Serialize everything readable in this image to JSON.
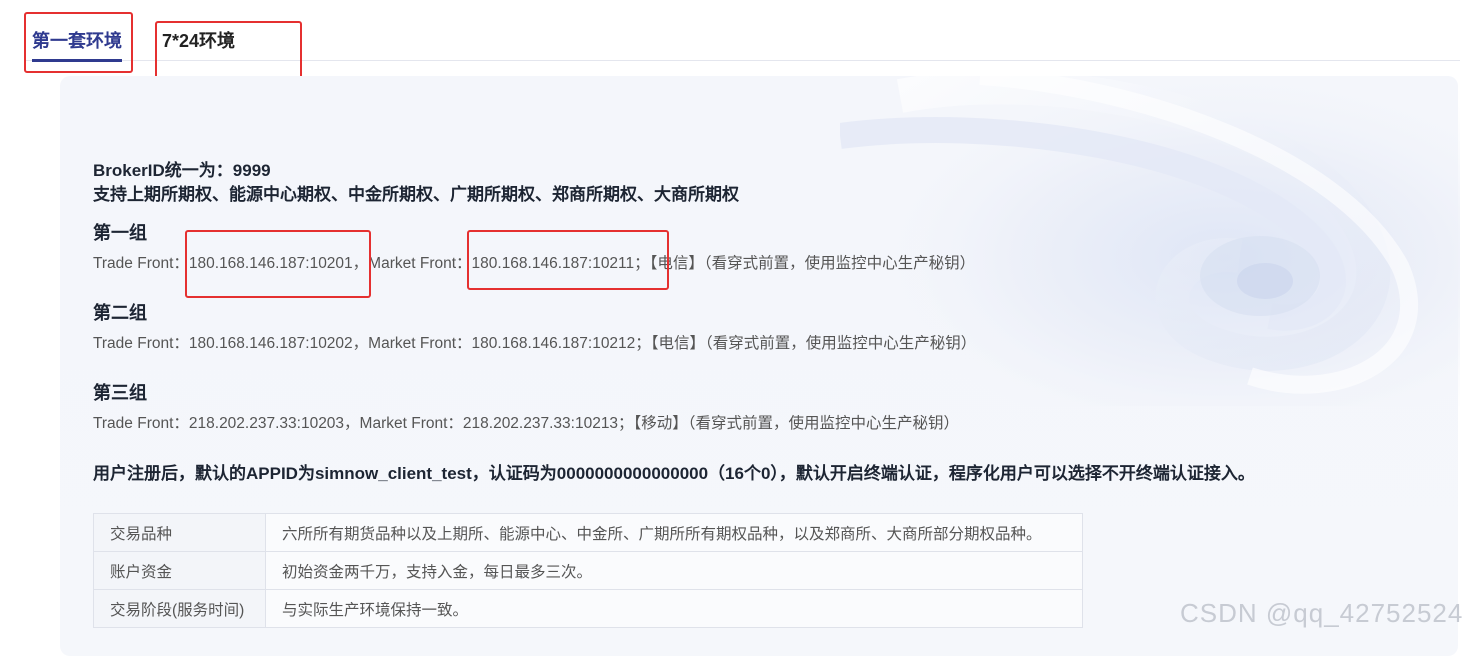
{
  "tabs": [
    {
      "label": "第一套环境",
      "active": true
    },
    {
      "label": "7*24环境",
      "active": false
    }
  ],
  "header": {
    "broker_line": "BrokerID统一为：9999",
    "support_line": "支持上期所期权、能源中心期权、中金所期权、广期所期权、郑商所期权、大商所期权"
  },
  "groups": [
    {
      "title": "第一组",
      "detail": "Trade Front：180.168.146.187:10201，Market Front：180.168.146.187:10211；【电信】（看穿式前置，使用监控中心生产秘钥）"
    },
    {
      "title": "第二组",
      "detail": "Trade Front：180.168.146.187:10202，Market Front：180.168.146.187:10212；【电信】（看穿式前置，使用监控中心生产秘钥）"
    },
    {
      "title": "第三组",
      "detail": "Trade Front：218.202.237.33:10203，Market Front：218.202.237.33:10213；【移动】（看穿式前置，使用监控中心生产秘钥）"
    }
  ],
  "notice": "用户注册后，默认的APPID为simnow_client_test，认证码为0000000000000000（16个0），默认开启终端认证，程序化用户可以选择不开终端认证接入。",
  "table": [
    {
      "key": "交易品种",
      "value": "六所所有期货品种以及上期所、能源中心、中金所、广期所所有期权品种，以及郑商所、大商所部分期权品种。"
    },
    {
      "key": "账户资金",
      "value": "初始资金两千万，支持入金，每日最多三次。"
    },
    {
      "key": "交易阶段(服务时间)",
      "value": "与实际生产环境保持一致。"
    }
  ],
  "watermark": "CSDN @qq_42752524",
  "colors": {
    "accent": "#2f3a8f",
    "highlight": "#e53030",
    "panel": "#f4f6fb"
  }
}
